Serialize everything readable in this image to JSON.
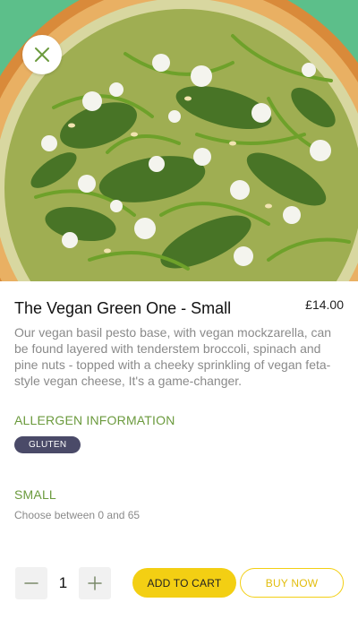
{
  "product": {
    "title": "The Vegan Green One - Small",
    "price": "£14.00",
    "description": "Our vegan basil pesto base, with vegan mockzarella, can be found layered with tenderstem broccoli, spinach and pine nuts - topped with a cheeky sprinkling of vegan feta-style vegan cheese, It's a game-changer."
  },
  "allergens": {
    "title": "ALLERGEN INFORMATION",
    "items": [
      "GLUTEN"
    ]
  },
  "size": {
    "title": "SMALL",
    "hint": "Choose between 0 and 65"
  },
  "cart": {
    "quantity": "1",
    "add_label": "ADD TO CART",
    "buy_label": "BUY NOW"
  },
  "icons": {
    "close": "close-icon",
    "minus": "minus-icon",
    "plus": "plus-icon"
  },
  "colors": {
    "accent_yellow": "#f3cf13",
    "section_green": "#6b9a3d",
    "badge_bg": "#4a4a68",
    "hero_bg": "#5cbf8a"
  }
}
